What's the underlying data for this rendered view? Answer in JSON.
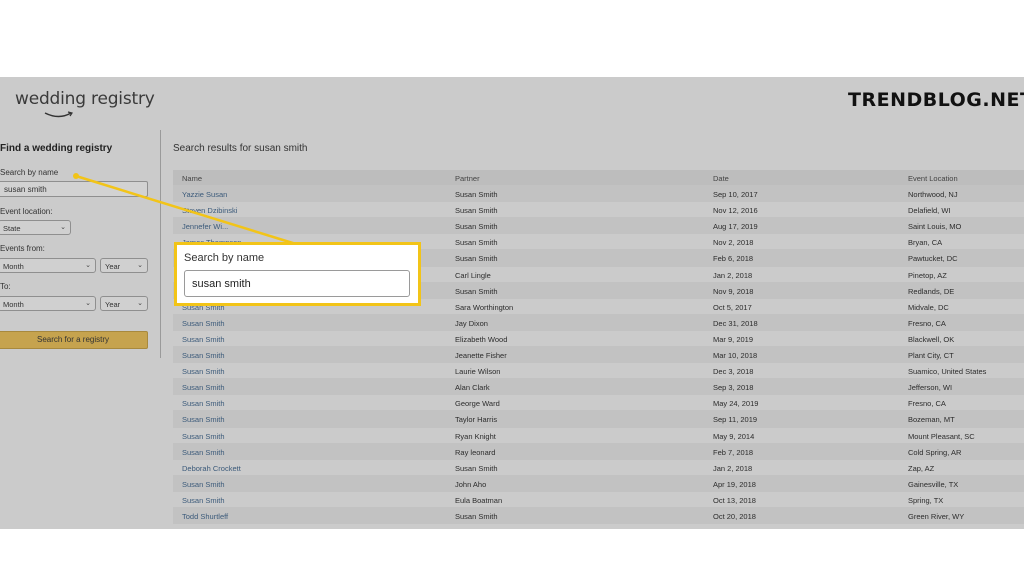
{
  "brand": {
    "logo_text": "wedding registry",
    "watermark": "TRENDBLOG.NET"
  },
  "sidebar": {
    "title": "Find a wedding registry",
    "search_label": "Search by name",
    "search_value": "susan smith",
    "event_location_label": "Event location:",
    "state_select": "State",
    "events_from_label": "Events from:",
    "from_month": "Month",
    "from_year": "Year",
    "to_label": "To:",
    "to_month": "Month",
    "to_year": "Year",
    "search_button": "Search for a registry"
  },
  "results": {
    "title": "Search results for susan smith",
    "columns": [
      "Name",
      "Partner",
      "Date",
      "Event Location"
    ],
    "rows": [
      [
        "Yazzie Susan",
        "Susan Smith",
        "Sep 10, 2017",
        "Northwood, NJ"
      ],
      [
        "Steven Dzibinski",
        "Susan Smith",
        "Nov 12, 2016",
        "Delafield, WI"
      ],
      [
        "Jennefer Wi...",
        "Susan Smith",
        "Aug 17, 2019",
        "Saint Louis, MO"
      ],
      [
        "James Thompson",
        "Susan Smith",
        "Nov 2, 2018",
        "Bryan, CA"
      ],
      [
        "",
        "Susan Smith",
        "Feb 6, 2018",
        "Pawtucket, DC"
      ],
      [
        "",
        "Carl Lingle",
        "Jan 2, 2018",
        "Pinetop, AZ"
      ],
      [
        "",
        "Susan Smith",
        "Nov 9, 2018",
        "Redlands, DE"
      ],
      [
        "Susan Smith",
        "Sara Worthington",
        "Oct 5, 2017",
        "Midvale, DC"
      ],
      [
        "Susan Smith",
        "Jay Dixon",
        "Dec 31, 2018",
        "Fresno, CA"
      ],
      [
        "Susan Smith",
        "Elizabeth Wood",
        "Mar 9, 2019",
        "Blackwell, OK"
      ],
      [
        "Susan Smith",
        "Jeanette Fisher",
        "Mar 10, 2018",
        "Plant City, CT"
      ],
      [
        "Susan Smith",
        "Laurie Wilson",
        "Dec 3, 2018",
        "Suamico, United States"
      ],
      [
        "Susan Smith",
        "Alan Clark",
        "Sep 3, 2018",
        "Jefferson, WI"
      ],
      [
        "Susan Smith",
        "George Ward",
        "May 24, 2019",
        "Fresno, CA"
      ],
      [
        "Susan Smith",
        "Taylor Harris",
        "Sep 11, 2019",
        "Bozeman, MT"
      ],
      [
        "Susan Smith",
        "Ryan Knight",
        "May 9, 2014",
        "Mount Pleasant, SC"
      ],
      [
        "Susan Smith",
        "Ray leonard",
        "Feb 7, 2018",
        "Cold Spring, AR"
      ],
      [
        "Deborah Crockett",
        "Susan Smith",
        "Jan 2, 2018",
        "Zap, AZ"
      ],
      [
        "Susan Smith",
        "John Aho",
        "Apr 19, 2018",
        "Gainesville, TX"
      ],
      [
        "Susan Smith",
        "Eula Boatman",
        "Oct 13, 2018",
        "Spring, TX"
      ],
      [
        "Todd Shurtleff",
        "Susan Smith",
        "Oct 20, 2018",
        "Green River, WY"
      ]
    ]
  },
  "callout": {
    "label": "Search by name",
    "value": "susan smith",
    "accent_color": "#f2c418"
  }
}
